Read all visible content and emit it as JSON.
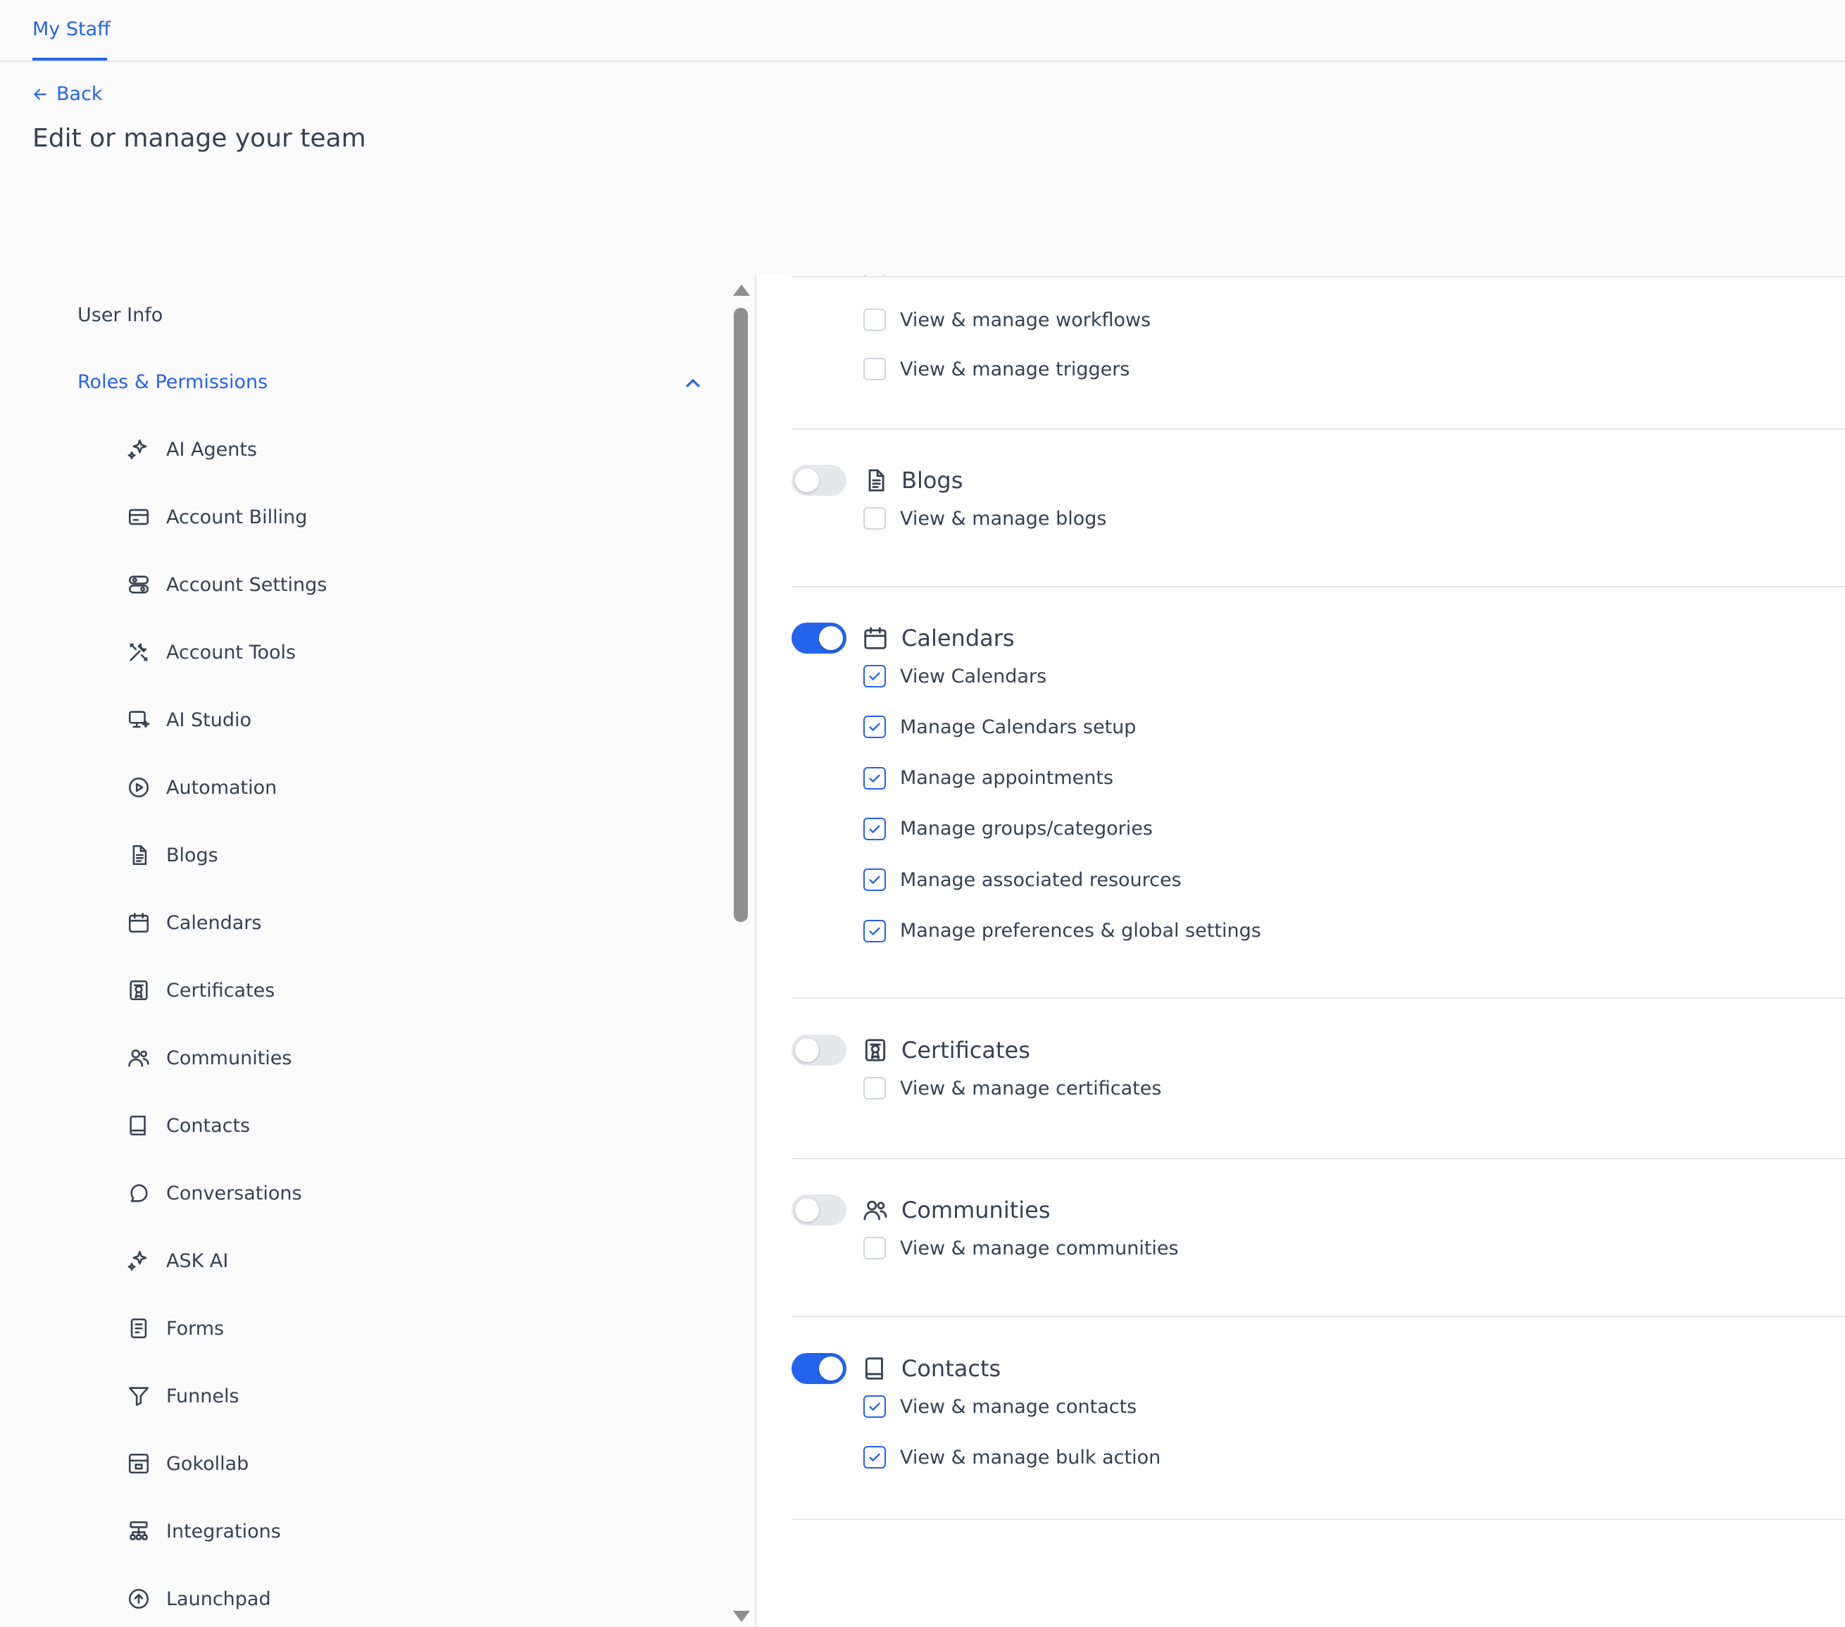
{
  "header": {
    "tab_label": "My Staff",
    "back_label": "Back",
    "page_title": "Edit or manage your team"
  },
  "sidebar": {
    "user_info": "User Info",
    "roles_permissions": "Roles & Permissions",
    "items": [
      {
        "label": "AI Agents",
        "icon": "sparkles-icon"
      },
      {
        "label": "Account Billing",
        "icon": "credit-card-icon"
      },
      {
        "label": "Account Settings",
        "icon": "settings-toggle-icon"
      },
      {
        "label": "Account Tools",
        "icon": "tools-icon"
      },
      {
        "label": "AI Studio",
        "icon": "ai-studio-icon"
      },
      {
        "label": "Automation",
        "icon": "play-circle-icon"
      },
      {
        "label": "Blogs",
        "icon": "document-icon"
      },
      {
        "label": "Calendars",
        "icon": "calendar-icon"
      },
      {
        "label": "Certificates",
        "icon": "certificate-icon"
      },
      {
        "label": "Communities",
        "icon": "users-icon"
      },
      {
        "label": "Contacts",
        "icon": "book-icon"
      },
      {
        "label": "Conversations",
        "icon": "chat-bubble-icon"
      },
      {
        "label": "ASK AI",
        "icon": "sparkles-icon"
      },
      {
        "label": "Forms",
        "icon": "form-icon"
      },
      {
        "label": "Funnels",
        "icon": "funnel-icon"
      },
      {
        "label": "Gokollab",
        "icon": "gokollab-icon"
      },
      {
        "label": "Integrations",
        "icon": "integrations-icon"
      },
      {
        "label": "Launchpad",
        "icon": "arrow-up-circle-icon"
      }
    ]
  },
  "permissions": {
    "automation_items": [
      {
        "label": "View & manage workflows",
        "checked": false
      },
      {
        "label": "View & manage triggers",
        "checked": false
      }
    ],
    "groups": [
      {
        "name": "Blogs",
        "icon": "document-icon",
        "enabled": false,
        "items": [
          {
            "label": "View & manage blogs",
            "checked": false
          }
        ]
      },
      {
        "name": "Calendars",
        "icon": "calendar-icon",
        "enabled": true,
        "items": [
          {
            "label": "View Calendars",
            "checked": true
          },
          {
            "label": "Manage Calendars setup",
            "checked": true
          },
          {
            "label": "Manage appointments",
            "checked": true
          },
          {
            "label": "Manage groups/categories",
            "checked": true
          },
          {
            "label": "Manage associated resources",
            "checked": true
          },
          {
            "label": "Manage preferences & global settings",
            "checked": true
          }
        ]
      },
      {
        "name": "Certificates",
        "icon": "certificate-icon",
        "enabled": false,
        "items": [
          {
            "label": "View & manage certificates",
            "checked": false
          }
        ]
      },
      {
        "name": "Communities",
        "icon": "users-icon",
        "enabled": false,
        "items": [
          {
            "label": "View & manage communities",
            "checked": false
          }
        ]
      },
      {
        "name": "Contacts",
        "icon": "book-icon",
        "enabled": true,
        "items": [
          {
            "label": "View & manage contacts",
            "checked": true
          },
          {
            "label": "View & manage bulk action",
            "checked": true
          }
        ]
      }
    ]
  },
  "colors": {
    "accent": "#2563eb",
    "text": "#374151",
    "border": "#e5e7eb",
    "scrollbar": "#8f8f8f"
  }
}
